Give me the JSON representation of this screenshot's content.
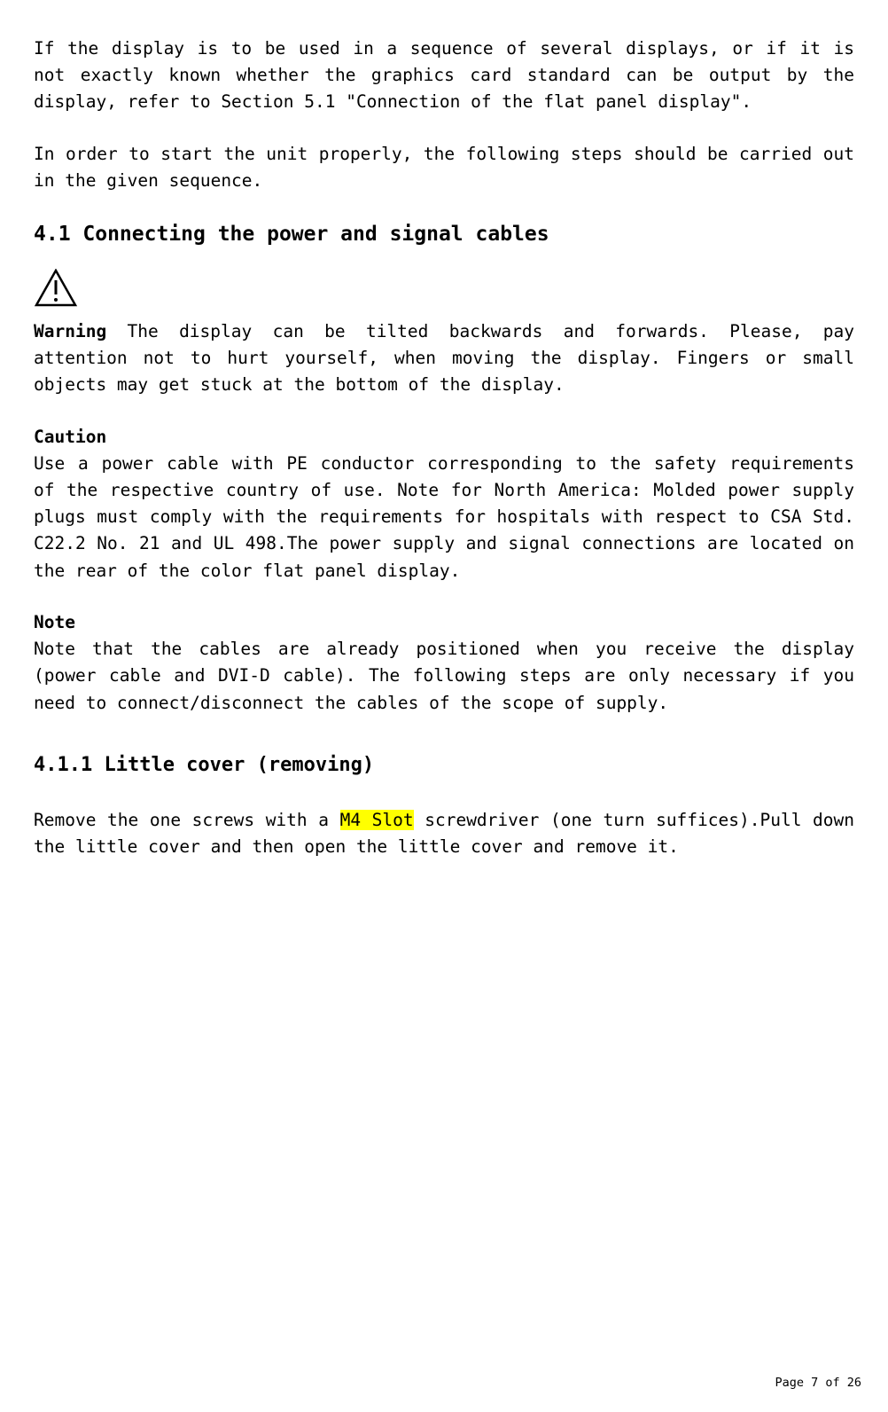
{
  "intro_para": "If the display is to be used in a sequence of several displays, or if it is not exactly known whether the graphics card standard can be output by the display, refer to Section 5.1 \"Connection of the flat panel display\".",
  "steps_para": "In order to start the unit properly, the following steps should be carried out in the given sequence.",
  "heading_4_1": "4.1 Connecting the power and signal cables",
  "warning_label": "Warning",
  "warning_text": " The display can be tilted backwards and forwards. Please, pay attention not to hurt yourself, when moving the display. Fingers or small objects may get stuck at the bottom of the display.",
  "caution_label": "Caution",
  "caution_text": "Use a power cable with PE conductor corresponding to the safety requirements of the respective country of use. Note for North America: Molded power supply plugs must comply with the requirements for hospitals with respect to CSA Std. C22.2 No. 21 and UL 498.The power supply and signal connections are located on the rear of the color flat panel display.",
  "note_label": "Note",
  "note_text": "Note that the cables are already positioned when you receive the display (power cable and DVI-D cable). The following steps are only necessary if you need to connect/disconnect the cables of the scope of supply.",
  "heading_4_1_1": "4.1.1 Little cover (removing)",
  "remove_pre": "Remove the one screws with a ",
  "remove_highlight": "M4 Slot",
  "remove_post": " screwdriver (one turn suffices).Pull down the little cover and then open the little cover and remove it.",
  "footer": "Page 7 of 26"
}
